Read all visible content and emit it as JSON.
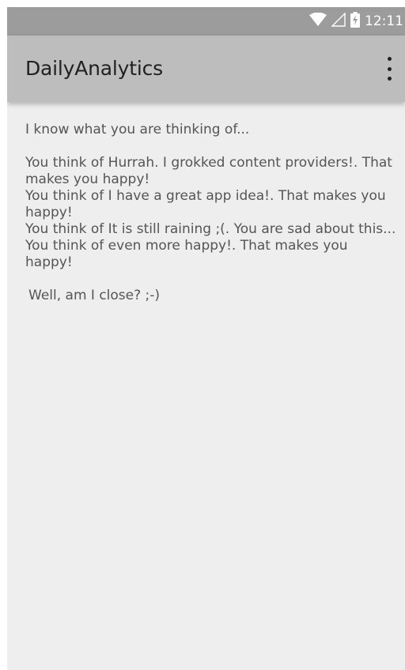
{
  "status_bar": {
    "time": "12:11",
    "icons": [
      "wifi-icon",
      "cell-signal-icon",
      "battery-charging-icon"
    ]
  },
  "app_bar": {
    "title": "DailyAnalytics",
    "menu_icon": "more-vert-icon"
  },
  "content": {
    "intro": "I know what you are thinking of...",
    "thoughts": [
      "You think of Hurrah. I grokked content providers!. That makes you happy!",
      "You think of I have a great app idea!. That makes you happy!",
      "You think of It is still raining ;(. You are sad about this...",
      "You think of even more happy!. That makes you happy!"
    ],
    "closing": "Well, am I close? ;-)"
  },
  "colors": {
    "status_bar_bg": "#9c9c9c",
    "app_bar_bg": "#bdbdbd",
    "content_bg": "#eeeeee",
    "body_text": "#555555",
    "title_text": "#212121"
  }
}
